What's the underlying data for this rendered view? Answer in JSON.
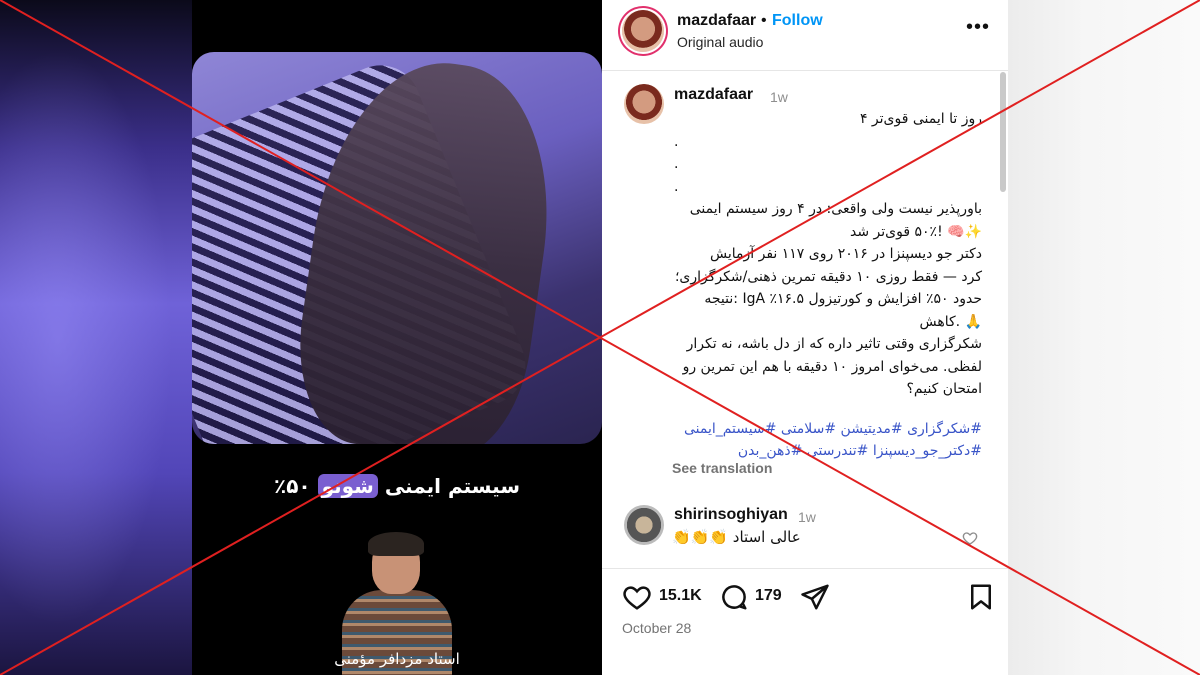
{
  "post": {
    "author": "mazdafaar",
    "follow_label": "Follow",
    "separator": "•",
    "audio": "Original audio",
    "more_label": "•••",
    "time": "1w",
    "caption_lines": [
      "روز تا ایمنی قوی‌تر ۴",
      ".",
      ".",
      ".",
      "باورپذیر نیست ولی واقعی: در ۴ روز سیستم ایمنی",
      "✨🧠 !۵۰٪ قوی‌تر شد",
      "دکتر جو دیسپنزا در ۲۰۱۶ روی ۱۱۷ نفر آزمایش",
      "کرد — فقط روزی ۱۰ دقیقه تمرین ذهنی/شکرگزاری؛",
      "حدود ۵۰٪ افزایش و کورتیزول ۱۶.۵٪ IgA :نتیجه",
      "🙏 .کاهش",
      "شکرگزاری وقتی تاثیر داره که از دل باشه، نه تکرار",
      "لفظی. می‌خوای امروز ۱۰ دقیقه با هم این تمرین رو",
      "امتحان کنیم؟"
    ],
    "hashtags_line1": "#شکرگزاری #مدیتیشن #سلامتی #سیستم_ایمنی",
    "hashtags_line2": "#دکتر_جو_دیسپنزا #تندرستی #ذهن_بدن",
    "see_translation": "See translation",
    "likes": "15.1K",
    "comments_count": "179",
    "date": "October 28"
  },
  "comment": {
    "user": "shirinsoghiyan",
    "time": "1w",
    "text": "عالی استاد 👏👏👏"
  },
  "video": {
    "caption_pre": "سیستم ایمنی ",
    "caption_highlight": "شونو",
    "caption_post": " ۵۰٪",
    "presenter_name": "استاد مزدافر مؤمنی"
  },
  "overlay": {
    "x_color": "#e02020"
  },
  "icons": [
    "heart-icon",
    "comment-icon",
    "share-icon",
    "bookmark-icon",
    "more-icon",
    "like-comment-icon"
  ]
}
